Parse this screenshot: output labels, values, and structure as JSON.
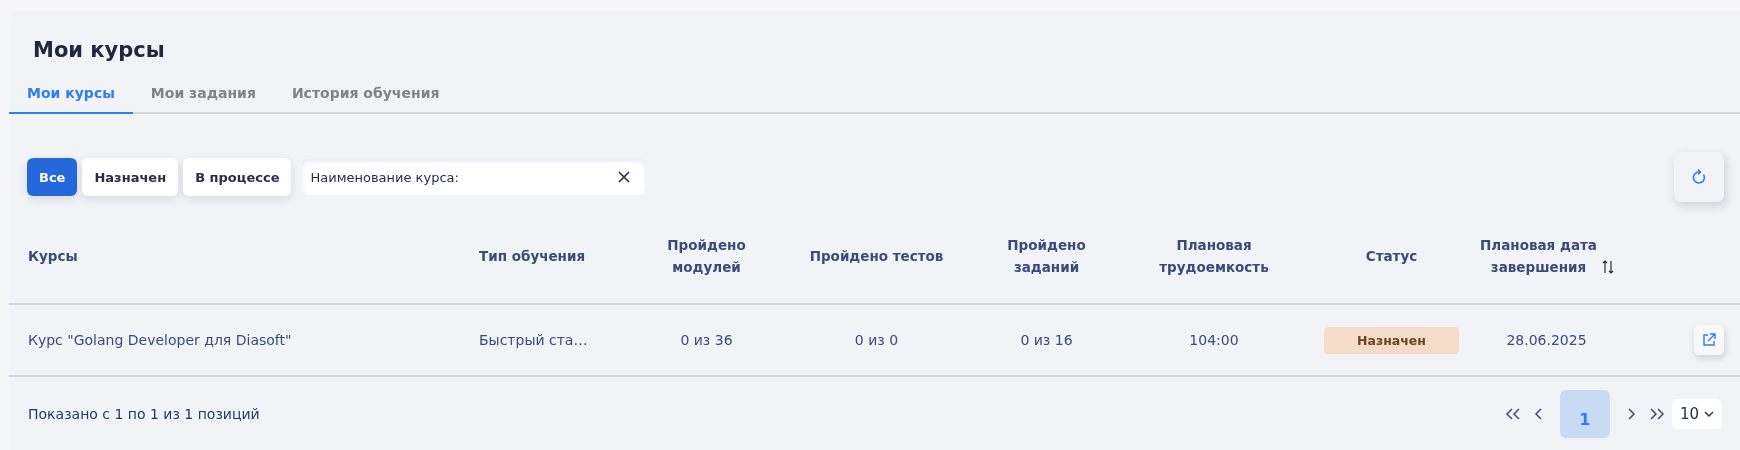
{
  "title": "Мои курсы",
  "tabs": [
    {
      "label": "Мои курсы",
      "selected": true
    },
    {
      "label": "Мои задания",
      "selected": false
    },
    {
      "label": "История обучения",
      "selected": false
    }
  ],
  "filters": [
    {
      "label": "Все",
      "selected": true
    },
    {
      "label": "Назначен",
      "selected": false
    },
    {
      "label": "В процессе",
      "selected": false
    }
  ],
  "search": {
    "placeholder": "Наименование курса:"
  },
  "table": {
    "columns": [
      {
        "label": "Курсы",
        "sortable": false
      },
      {
        "label": "Тип обучения",
        "sortable": false
      },
      {
        "label": "Пройдено модулей",
        "sortable": false
      },
      {
        "label": "Пройдено тестов",
        "sortable": false
      },
      {
        "label": "Пройдено заданий",
        "sortable": false
      },
      {
        "label": "Плановая трудоемкость",
        "sortable": false
      },
      {
        "label": "Статус",
        "sortable": false
      },
      {
        "label": "Плановая дата завершения",
        "sortable": true
      }
    ],
    "rows": [
      {
        "course": "Курс \"Golang Developer для Diasoft\"",
        "type": "Быстрый ста…",
        "modules": "0 из 36",
        "tests": "0 из 0",
        "tasks": "0 из 16",
        "effort": "104:00",
        "status": "Назначен",
        "date": "28.06.2025"
      }
    ]
  },
  "footer": {
    "summary": "Показано с 1 по 1 из 1 позиций",
    "pages": [
      {
        "label": "1",
        "selected": true
      }
    ],
    "page_size": "10"
  }
}
